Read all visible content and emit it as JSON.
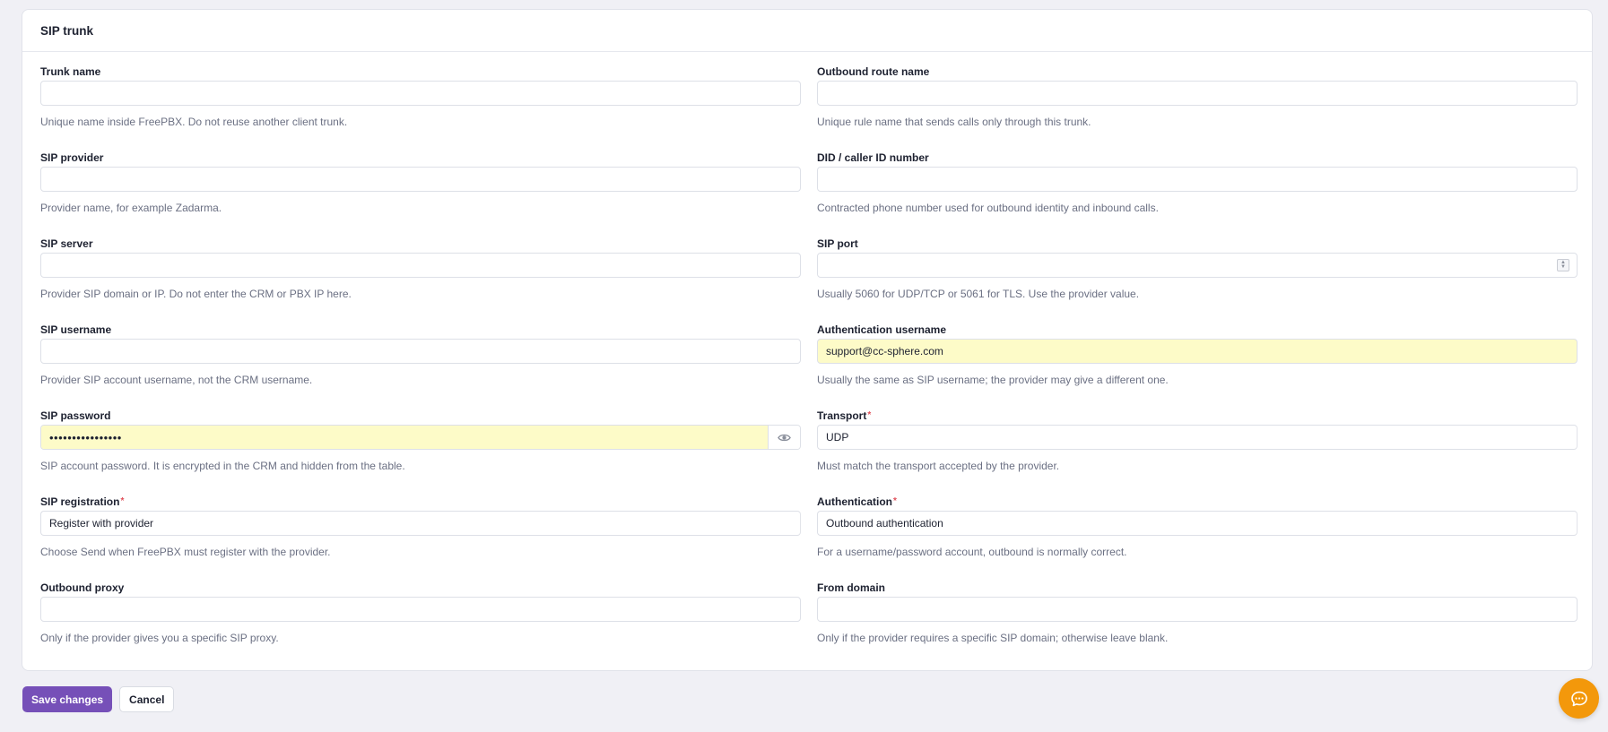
{
  "card": {
    "title": "SIP trunk"
  },
  "fields": {
    "trunk_name": {
      "label": "Trunk name",
      "value": "",
      "help": "Unique name inside FreePBX. Do not reuse another client trunk."
    },
    "outbound_route_name": {
      "label": "Outbound route name",
      "value": "",
      "help": "Unique rule name that sends calls only through this trunk."
    },
    "sip_provider": {
      "label": "SIP provider",
      "value": "",
      "help": "Provider name, for example Zadarma."
    },
    "did": {
      "label": "DID / caller ID number",
      "value": "",
      "help": "Contracted phone number used for outbound identity and inbound calls."
    },
    "sip_server": {
      "label": "SIP server",
      "value": "",
      "help": "Provider SIP domain or IP. Do not enter the CRM or PBX IP here."
    },
    "sip_port": {
      "label": "SIP port",
      "value": "",
      "help": "Usually 5060 for UDP/TCP or 5061 for TLS. Use the provider value."
    },
    "sip_username": {
      "label": "SIP username",
      "value": "",
      "help": "Provider SIP account username, not the CRM username."
    },
    "auth_username": {
      "label": "Authentication username",
      "value": "support@cc-sphere.com",
      "help": "Usually the same as SIP username; the provider may give a different one."
    },
    "sip_password": {
      "label": "SIP password",
      "value": "••••••••••••••••",
      "help": "SIP account password. It is encrypted in the CRM and hidden from the table."
    },
    "transport": {
      "label": "Transport",
      "required": "*",
      "value": "UDP",
      "help": "Must match the transport accepted by the provider."
    },
    "sip_registration": {
      "label": "SIP registration",
      "required": "*",
      "value": "Register with provider",
      "help": "Choose Send when FreePBX must register with the provider."
    },
    "authentication": {
      "label": "Authentication",
      "required": "*",
      "value": "Outbound authentication",
      "help": "For a username/password account, outbound is normally correct."
    },
    "outbound_proxy": {
      "label": "Outbound proxy",
      "value": "",
      "help": "Only if the provider gives you a specific SIP proxy."
    },
    "from_domain": {
      "label": "From domain",
      "value": "",
      "help": "Only if the provider requires a specific SIP domain; otherwise leave blank."
    }
  },
  "actions": {
    "save_label": "Save changes",
    "cancel_label": "Cancel"
  },
  "icons": {
    "password_toggle": "eye-icon",
    "chat": "chat-bubble-icon"
  },
  "colors": {
    "primary": "#7650b8",
    "autofill": "#fdfbc8",
    "chat": "#f3980b",
    "required": "#e0505a"
  }
}
